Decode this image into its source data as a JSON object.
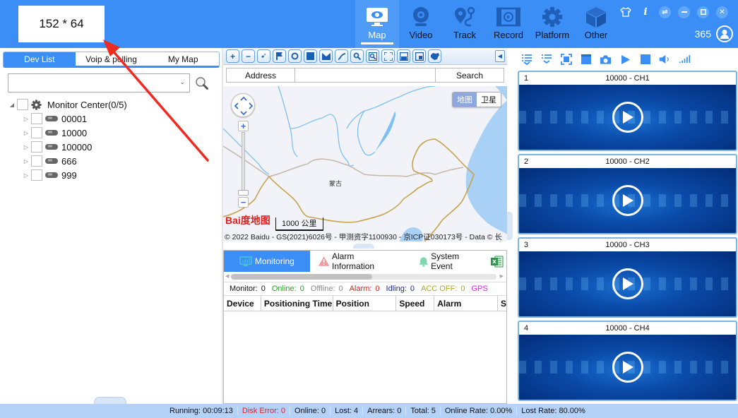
{
  "size_label": "152 * 64",
  "nav": [
    {
      "label": "Map",
      "icon": "monitor-eye-icon",
      "active": true
    },
    {
      "label": "Video",
      "icon": "webcam-icon",
      "active": false
    },
    {
      "label": "Track",
      "icon": "route-pin-icon",
      "active": false
    },
    {
      "label": "Record",
      "icon": "film-replay-icon",
      "active": false
    },
    {
      "label": "Platform",
      "icon": "gear-icon",
      "active": false
    },
    {
      "label": "Other",
      "icon": "cube-icon",
      "active": false
    }
  ],
  "window_controls": [
    "skin-icon",
    "info-icon",
    "switch-icon",
    "minimize-icon",
    "maximize-icon",
    "close-icon"
  ],
  "user": {
    "count": "365"
  },
  "left": {
    "tabs": [
      {
        "label": "Dev List",
        "active": true
      },
      {
        "label": "Voip & polling",
        "active": false
      },
      {
        "label": "My Map",
        "active": false
      }
    ],
    "search_value": "",
    "tree": {
      "root": "Monitor Center(0/5)",
      "children": [
        "00001",
        "10000",
        "100000",
        "666",
        "999"
      ]
    }
  },
  "map": {
    "tools": [
      "zoom-in",
      "zoom-out",
      "measure",
      "flag",
      "circle",
      "rectangle",
      "polygon",
      "polyline",
      "search",
      "search-area",
      "fullscreen",
      "save",
      "layer",
      "china-map"
    ],
    "address_label": "Address",
    "address_value": "",
    "search_label": "Search",
    "type_map": "地图",
    "type_satellite": "卫星",
    "place_label": "蒙古",
    "baidu_logo": "Bai度地图",
    "scale": "1000 公里",
    "copyright": "© 2022 Baidu - GS(2021)6026号 - 甲测资字1100930 - 京ICP证030173号 - Data © 长"
  },
  "bottom": {
    "tabs": [
      {
        "label": "Monitoring",
        "active": true
      },
      {
        "label": "Alarm Information",
        "active": false
      },
      {
        "label": "System Event",
        "active": false
      }
    ],
    "stats": [
      {
        "label": "Monitor:",
        "value": "0",
        "color": "#111111"
      },
      {
        "label": "Online:",
        "value": "0",
        "color": "#2aa02a"
      },
      {
        "label": "Offline:",
        "value": "0",
        "color": "#888888"
      },
      {
        "label": "Alarm:",
        "value": "0",
        "color": "#e02020"
      },
      {
        "label": "Idling:",
        "value": "0",
        "color": "#1a2a8a"
      },
      {
        "label": "ACC OFF:",
        "value": "0",
        "color": "#a8a820"
      },
      {
        "label": "GPS",
        "value": "",
        "color": "#e020e0"
      }
    ],
    "columns": [
      "Device",
      "Positioning Time",
      "Position",
      "Speed",
      "Alarm",
      "S"
    ]
  },
  "video": {
    "tools": [
      "list-expand-icon",
      "list-collapse-icon",
      "fullscreen-icon",
      "window-icon",
      "camera-icon",
      "play-icon",
      "stop-icon",
      "volume-icon",
      "signal-icon"
    ],
    "cells": [
      {
        "index": "1",
        "title": "10000 - CH1"
      },
      {
        "index": "2",
        "title": "10000 - CH2"
      },
      {
        "index": "3",
        "title": "10000 - CH3"
      },
      {
        "index": "4",
        "title": "10000 - CH4"
      }
    ]
  },
  "status": {
    "running": "Running: 00:09:13",
    "disk_error": "Disk Error: 0",
    "online": "Online: 0",
    "lost": "Lost: 4",
    "arrears": "Arrears: 0",
    "total": "Total: 5",
    "online_rate": "Online Rate: 0.00%",
    "lost_rate": "Lost Rate: 80.00%"
  },
  "colors": {
    "accent": "#3a8ef6",
    "statusbar": "#b4d1f8",
    "annotation_arrow": "#f02a20"
  }
}
